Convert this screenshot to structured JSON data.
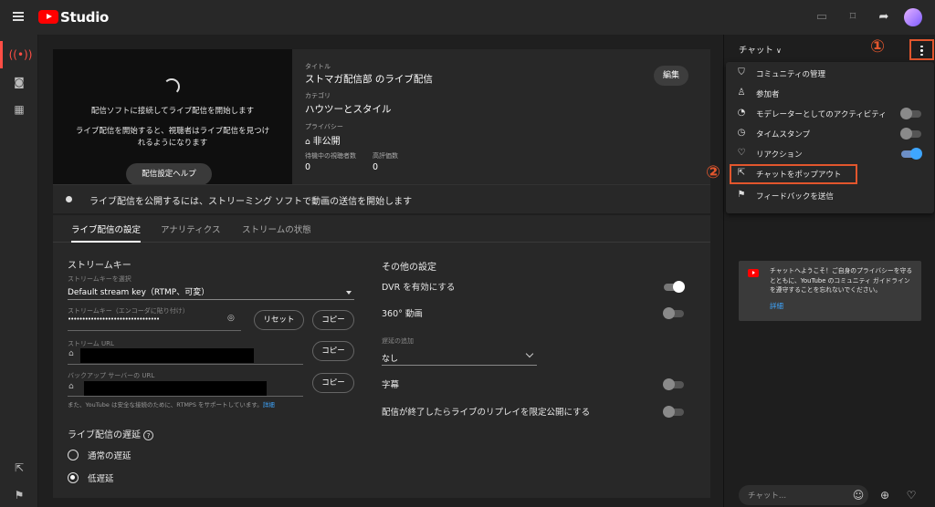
{
  "topbar": {
    "logo_text": "Studio"
  },
  "preview": {
    "line1": "配信ソフトに接続してライブ配信を開始します",
    "line2": "ライブ配信を開始すると、視聴者はライブ配信を見つけ",
    "line3": "れるようになります",
    "help_button": "配信設定ヘルプ"
  },
  "stream_info": {
    "title_label": "タイトル",
    "title": "ストマガ配信部 のライブ配信",
    "category_label": "カテゴリ",
    "category": "ハウツーとスタイル",
    "privacy_label": "プライバシー",
    "privacy": "非公開",
    "viewers_label": "待機中の視聴者数",
    "viewers": "0",
    "likes_label": "高評価数",
    "likes": "0",
    "edit_button": "編集"
  },
  "status": {
    "text": "ライブ配信を公開するには、ストリーミング ソフトで動画の送信を開始します"
  },
  "tabs": [
    "ライブ配信の設定",
    "アナリティクス",
    "ストリームの状態"
  ],
  "stream_key": {
    "section_title": "ストリームキー",
    "select_label": "ストリームキーを選択",
    "select_value": "Default stream key（RTMP、可変）",
    "key_label": "ストリームキー（エンコーダに貼り付け）",
    "key_value": "••••••••••••••••••••••••••••••••",
    "reset_button": "リセット",
    "copy_button": "コピー",
    "url_label": "ストリーム URL",
    "backup_label": "バックアップ サーバーの URL",
    "hint": "また、YouTube は安全な接続のために、RTMPS をサポートしています。",
    "hint_link": "詳細"
  },
  "latency": {
    "section_title": "ライブ配信の遅延",
    "options": [
      "通常の遅延",
      "低遅延"
    ],
    "selected": "低遅延"
  },
  "other": {
    "section_title": "その他の設定",
    "dvr": "DVR を有効にする",
    "dvr_on": true,
    "video360": "360° 動画",
    "video360_on": false,
    "delay_label": "遅延の追加",
    "delay_value": "なし",
    "captions": "字幕",
    "captions_on": false,
    "replay": "配信が終了したらライブのリプレイを限定公開にする",
    "replay_on": false
  },
  "chat": {
    "title": "チャット",
    "menu": [
      {
        "label": "コミュニティの管理",
        "icon": "shield-icon"
      },
      {
        "label": "参加者",
        "icon": "person-icon"
      },
      {
        "label": "モデレーターとしてのアクティビティ",
        "icon": "moderator-icon",
        "toggle": false
      },
      {
        "label": "タイムスタンプ",
        "icon": "clock-icon",
        "toggle": false
      },
      {
        "label": "リアクション",
        "icon": "heart-icon",
        "toggle": true
      },
      {
        "label": "チャットをポップアウト",
        "icon": "popout-icon"
      },
      {
        "label": "フィードバックを送信",
        "icon": "feedback-icon"
      }
    ],
    "welcome": "チャットへようこそ！ご自身のプライバシーを守るとともに、YouTube のコミュニティ ガイドラインを遵守することを忘れないでください。",
    "welcome_link": "詳細",
    "input_placeholder": "チャット...",
    "annotation1": "①",
    "annotation2": "②"
  },
  "colors": {
    "accent": "#ff0000",
    "annotation": "#e2562d",
    "link": "#3ea6ff"
  }
}
